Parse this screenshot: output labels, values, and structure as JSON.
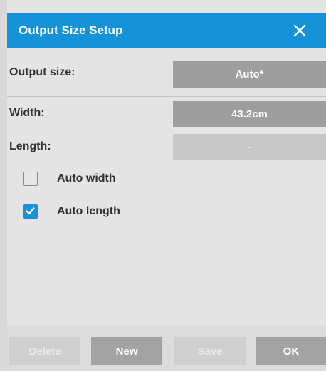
{
  "dialog": {
    "title": "Output Size Setup",
    "close_icon": "close-icon"
  },
  "fields": {
    "output_size": {
      "label": "Output size:",
      "value": "Auto*"
    },
    "width": {
      "label": "Width:",
      "value": "43.2cm"
    },
    "length": {
      "label": "Length:",
      "value": "-"
    }
  },
  "options": {
    "auto_width": {
      "label": "Auto width",
      "checked": false
    },
    "auto_length": {
      "label": "Auto length",
      "checked": true
    }
  },
  "footer": {
    "delete_label": "Delete",
    "new_label": "New",
    "save_label": "Save",
    "ok_label": "OK"
  },
  "colors": {
    "accent": "#1592d8",
    "button": "#9e9e9e",
    "background": "#e4e4e4"
  }
}
